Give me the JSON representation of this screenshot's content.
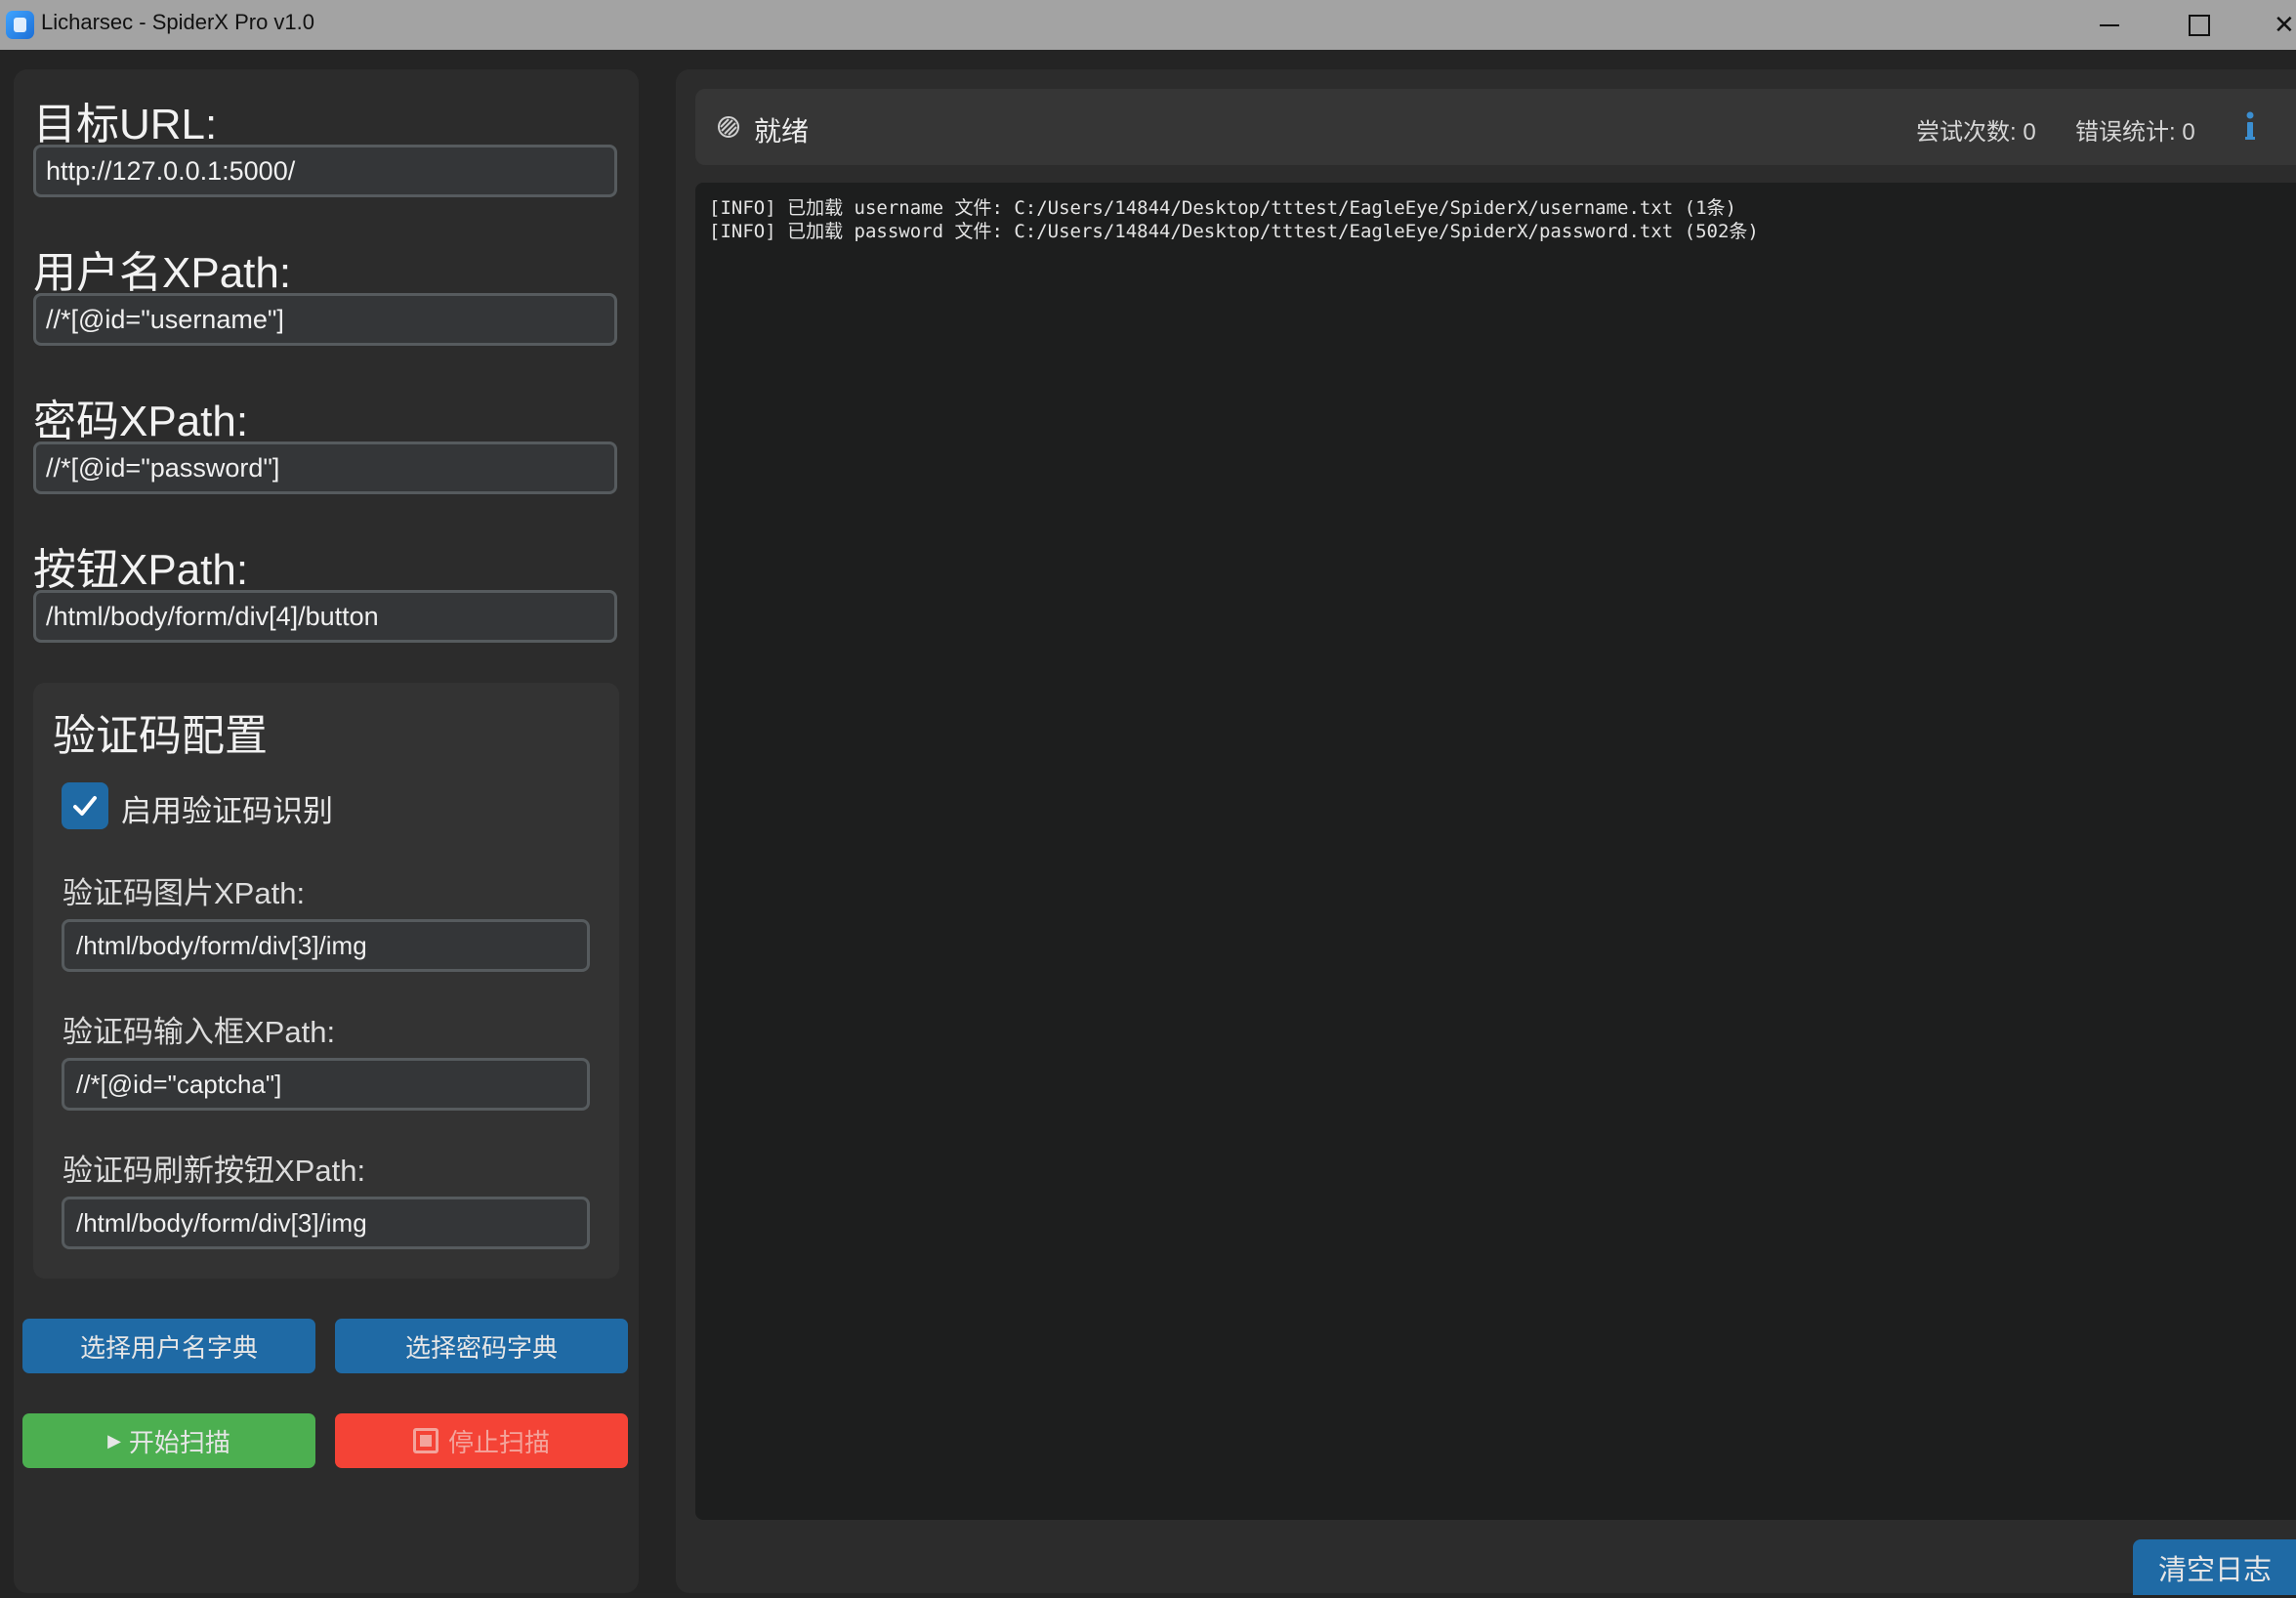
{
  "window": {
    "title": "Licharsec - SpiderX Pro v1.0",
    "close_glyph": "✕"
  },
  "form": {
    "url_label": "目标URL:",
    "url_value": "http://127.0.0.1:5000/",
    "username_xpath_label": "用户名XPath:",
    "username_xpath_value": "//*[@id=\"username\"]",
    "password_xpath_label": "密码XPath:",
    "password_xpath_value": "//*[@id=\"password\"]",
    "button_xpath_label": "按钮XPath:",
    "button_xpath_value": "/html/body/form/div[4]/button"
  },
  "captcha": {
    "title": "验证码配置",
    "enable_label": "启用验证码识别",
    "enabled": true,
    "image_xpath_label": "验证码图片XPath:",
    "image_xpath_value": "/html/body/form/div[3]/img",
    "input_xpath_label": "验证码输入框XPath:",
    "input_xpath_value": "//*[@id=\"captcha\"]",
    "refresh_xpath_label": "验证码刷新按钮XPath:",
    "refresh_xpath_value": "/html/body/form/div[3]/img"
  },
  "buttons": {
    "select_username_dict": "选择用户名字典",
    "select_password_dict": "选择密码字典",
    "start_scan": "开始扫描",
    "stop_scan": "停止扫描",
    "clear_log": "清空日志"
  },
  "status": {
    "text": "就绪",
    "attempts": "尝试次数: 0",
    "errors": "错误统计: 0"
  },
  "log": {
    "lines": [
      "[INFO] 已加载 username 文件: C:/Users/14844/Desktop/tttest/EagleEye/SpiderX/username.txt (1条)",
      "[INFO] 已加载 password 文件: C:/Users/14844/Desktop/tttest/EagleEye/SpiderX/password.txt (502条)"
    ]
  },
  "colors": {
    "accent_blue": "#1f6aa5",
    "start_green": "#4caf50",
    "stop_red": "#f44336",
    "info_blue": "#3b8ed0"
  },
  "icons": {
    "app": "app-icon",
    "status": "status-spinner-icon",
    "info": "info-icon",
    "check": "checkmark-icon",
    "play": "play-icon",
    "stop": "stop-icon"
  }
}
